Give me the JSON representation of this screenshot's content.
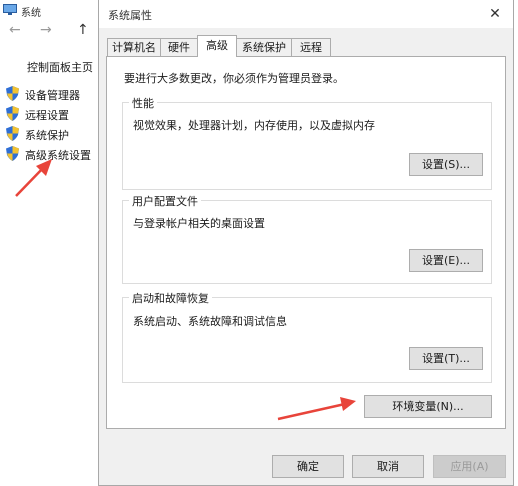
{
  "background": {
    "title": "系统",
    "nav": {
      "back": "←",
      "forward": "→",
      "up": "↑"
    },
    "control_panel_home": "控制面板主页",
    "sidebar": [
      {
        "label": "设备管理器"
      },
      {
        "label": "远程设置"
      },
      {
        "label": "系统保护"
      },
      {
        "label": "高级系统设置"
      }
    ]
  },
  "dialog": {
    "title": "系统属性",
    "close": "✕",
    "tabs": [
      {
        "label": "计算机名"
      },
      {
        "label": "硬件"
      },
      {
        "label": "高级"
      },
      {
        "label": "系统保护"
      },
      {
        "label": "远程"
      }
    ],
    "active_tab": "高级",
    "admin_note": "要进行大多数更改，你必须作为管理员登录。",
    "groups": {
      "performance": {
        "title": "性能",
        "description": "视觉效果，处理器计划，内存使用，以及虚拟内存",
        "button": "设置(S)..."
      },
      "profiles": {
        "title": "用户配置文件",
        "description": "与登录帐户相关的桌面设置",
        "button": "设置(E)..."
      },
      "startup": {
        "title": "启动和故障恢复",
        "description": "系统启动、系统故障和调试信息",
        "button": "设置(T)..."
      }
    },
    "env_button": "环境变量(N)...",
    "footer": {
      "ok": "确定",
      "cancel": "取消",
      "apply": "应用(A)"
    }
  },
  "colors": {
    "annotation_arrow": "#e8443a",
    "shield_blue": "#2f6fd6",
    "shield_yellow": "#f2c230"
  }
}
